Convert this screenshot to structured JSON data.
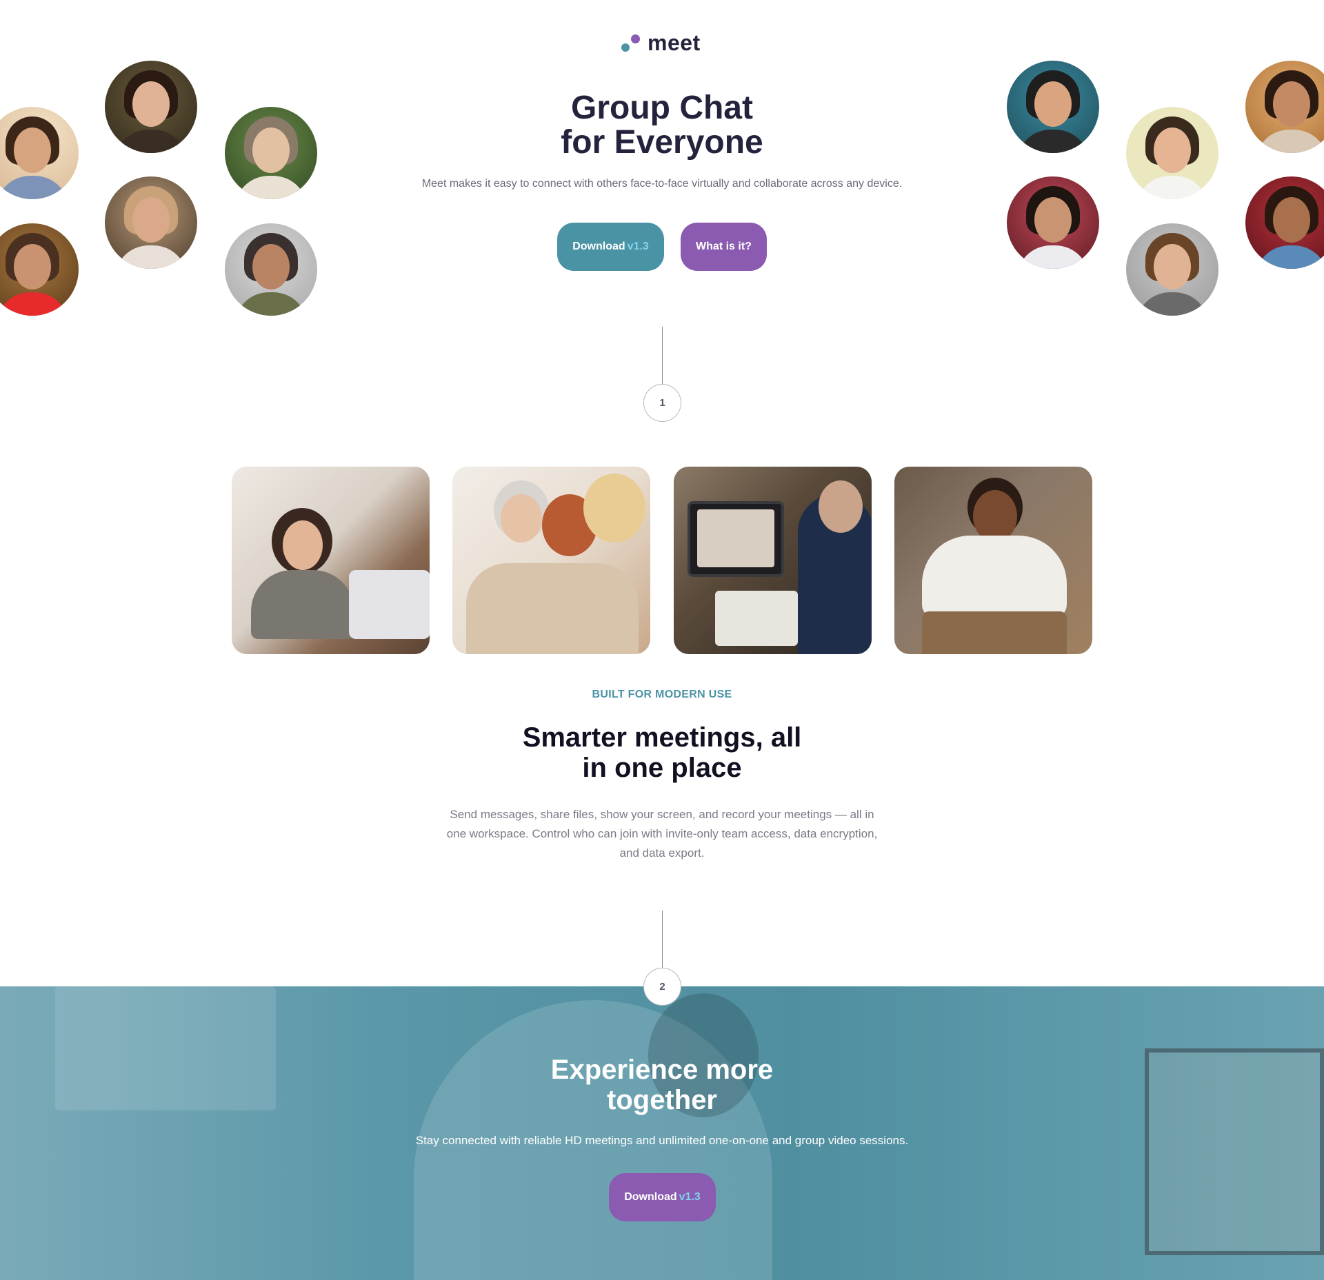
{
  "brand": {
    "name": "meet",
    "accent": "#4a93a5",
    "accent2": "#8a5bb0",
    "dark": "#23233d"
  },
  "hero": {
    "title_line1": "Group Chat",
    "title_line2": "for Everyone",
    "subtitle": "Meet makes it easy to connect with others face-to-face virtually and collaborate across any device.",
    "download_label": "Download",
    "download_version": "v1.3",
    "what_label": "What is it?"
  },
  "steps": {
    "one": "1",
    "two": "2"
  },
  "features": {
    "eyebrow": "BUILT FOR MODERN USE",
    "title_line1": "Smarter meetings, all",
    "title_line2": "in one place",
    "description": "Send messages, share files, show your screen, and record your meetings — all in one workspace. Control who can join with invite-only team access, data encryption, and data export."
  },
  "cta": {
    "title_line1": "Experience more",
    "title_line2": "together",
    "subtitle": "Stay connected with reliable HD meetings and unlimited one-on-one and group video sessions.",
    "download_label": "Download",
    "download_version": "v1.3"
  }
}
